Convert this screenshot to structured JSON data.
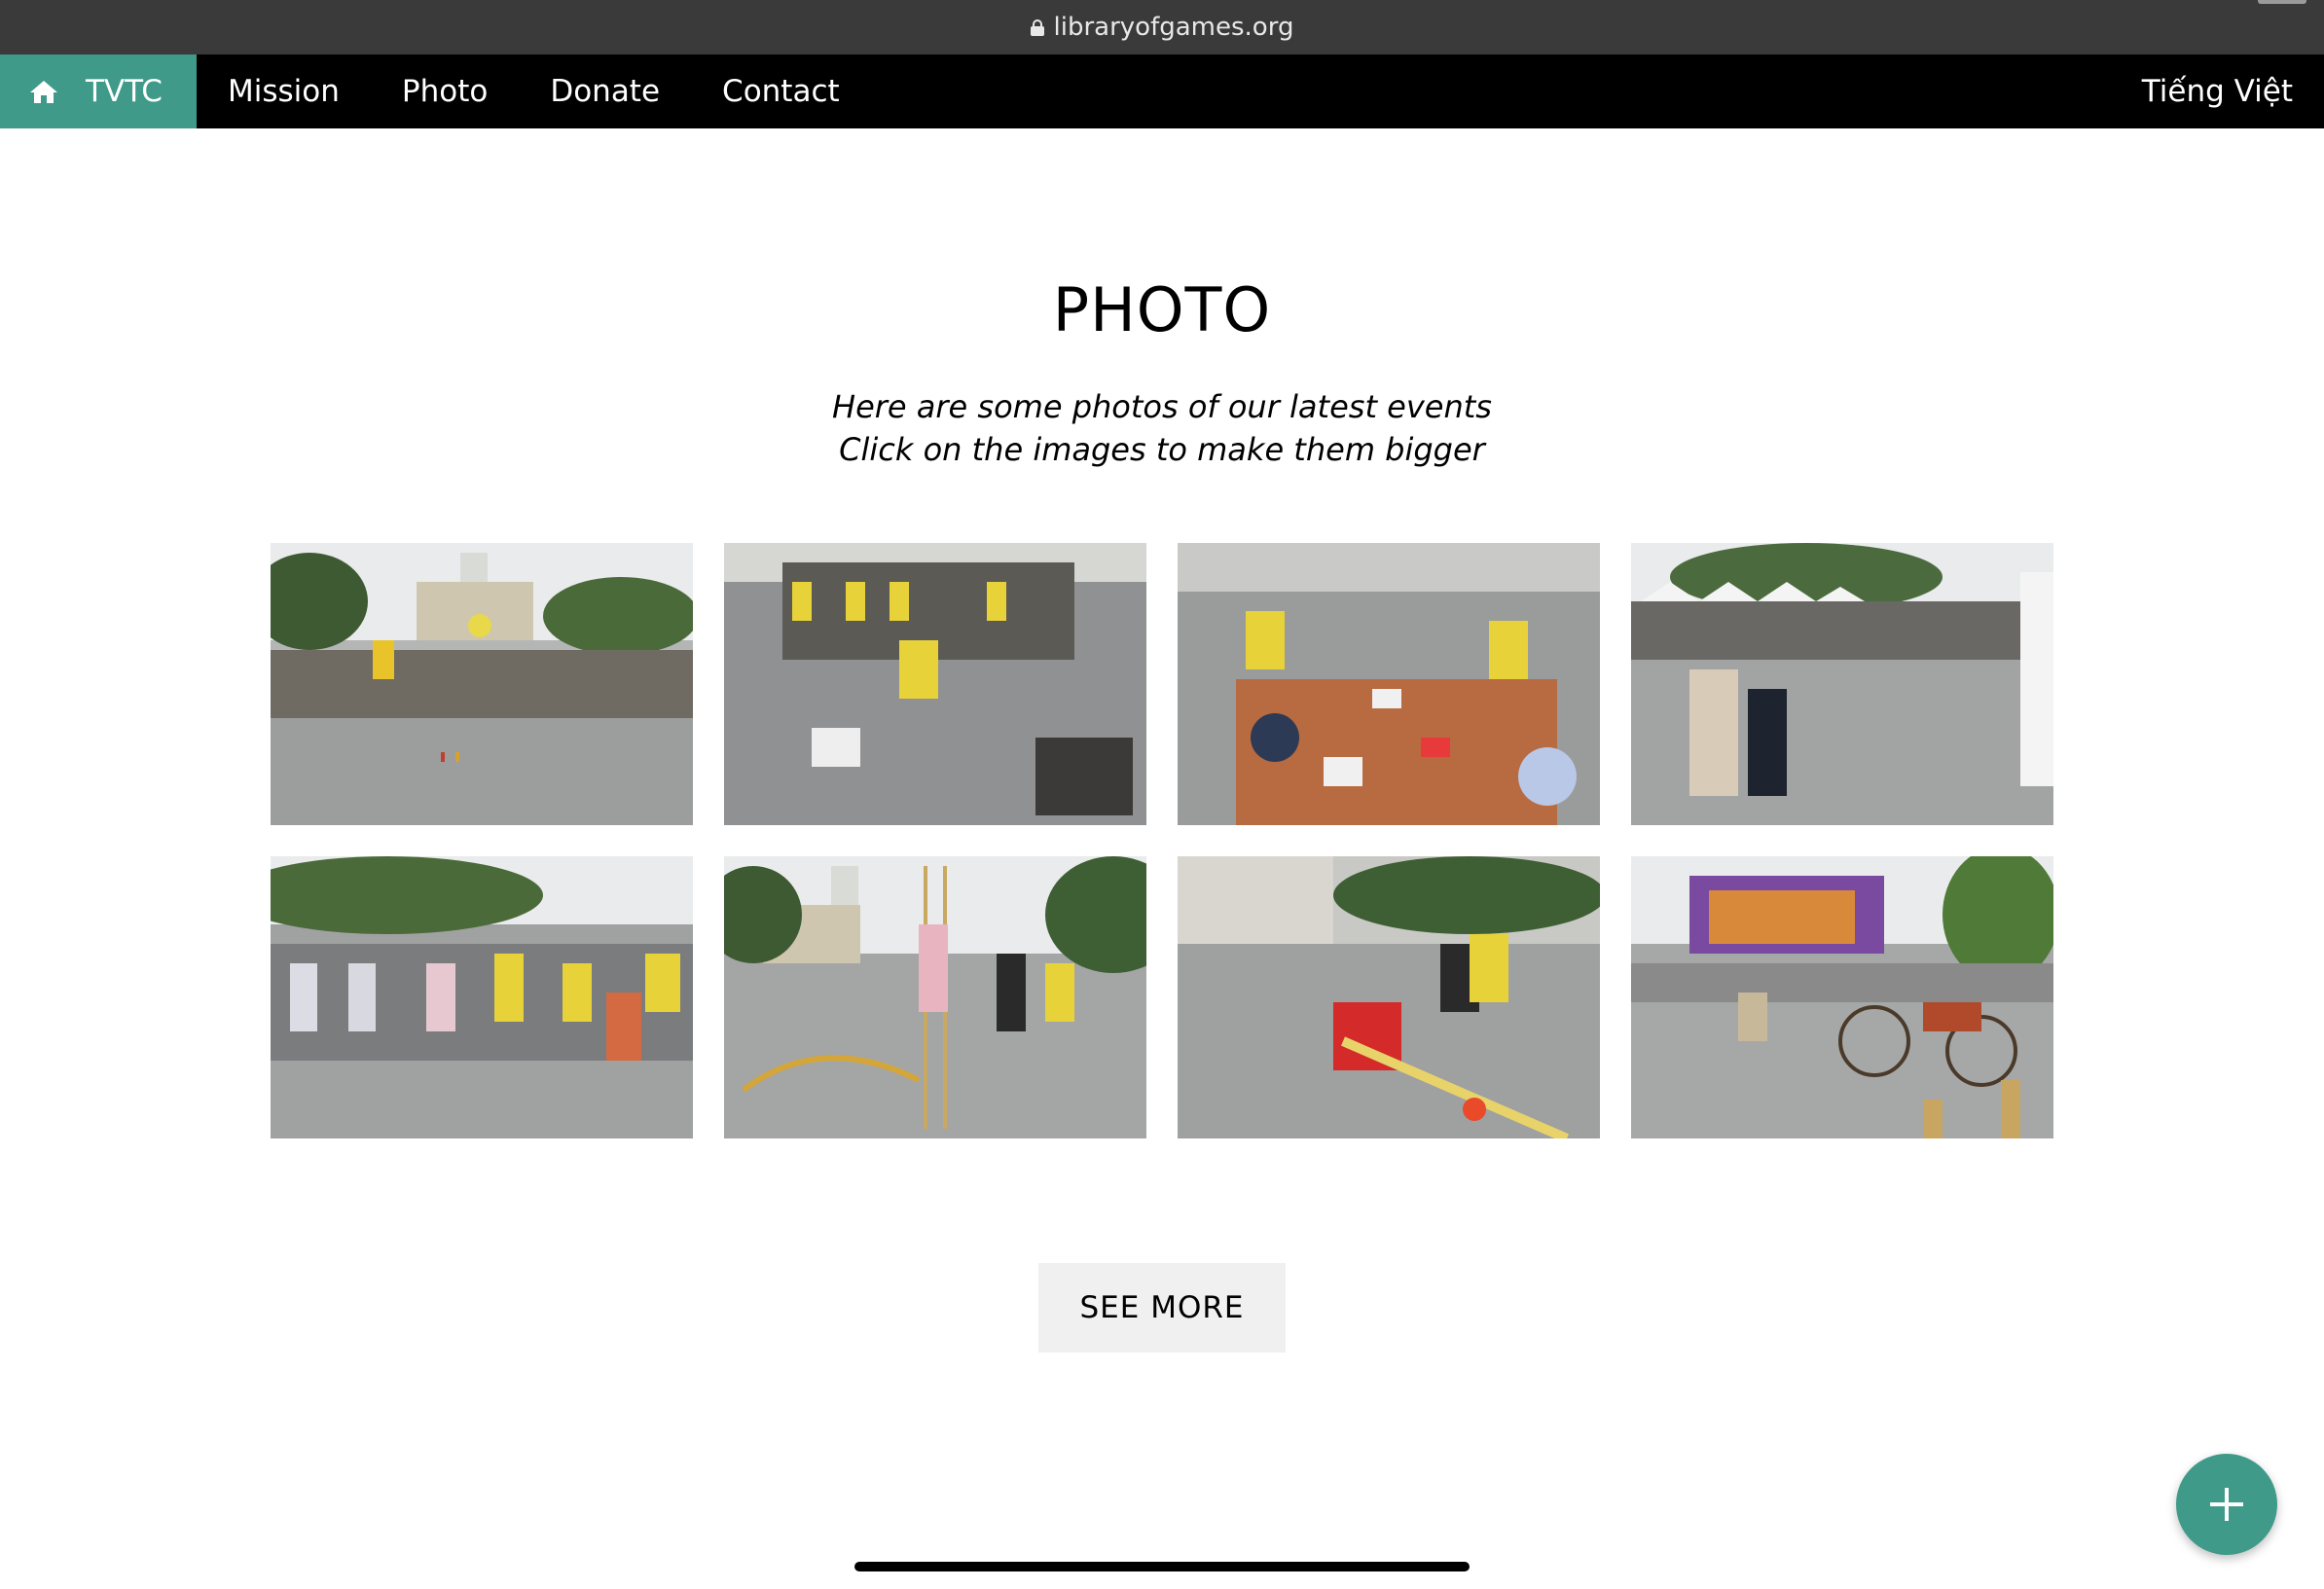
{
  "browser": {
    "url": "libraryofgames.org"
  },
  "nav": {
    "home_label": "TVTC",
    "items": [
      {
        "label": "Mission"
      },
      {
        "label": "Photo"
      },
      {
        "label": "Donate"
      },
      {
        "label": "Contact"
      }
    ],
    "language": "Tiếng Việt",
    "accent_color": "#3f9a8a"
  },
  "main": {
    "title": "PHOTO",
    "subtitle_line1": "Here are some photos of our latest events",
    "subtitle_line2": "Click on the images to make them bigger",
    "photos": [
      {
        "name": "event-photo-1"
      },
      {
        "name": "event-photo-2"
      },
      {
        "name": "event-photo-3"
      },
      {
        "name": "event-photo-4"
      },
      {
        "name": "event-photo-5"
      },
      {
        "name": "event-photo-6"
      },
      {
        "name": "event-photo-7"
      },
      {
        "name": "event-photo-8"
      }
    ],
    "see_more_label": "SEE MORE"
  },
  "fab": {
    "icon": "plus-icon"
  }
}
